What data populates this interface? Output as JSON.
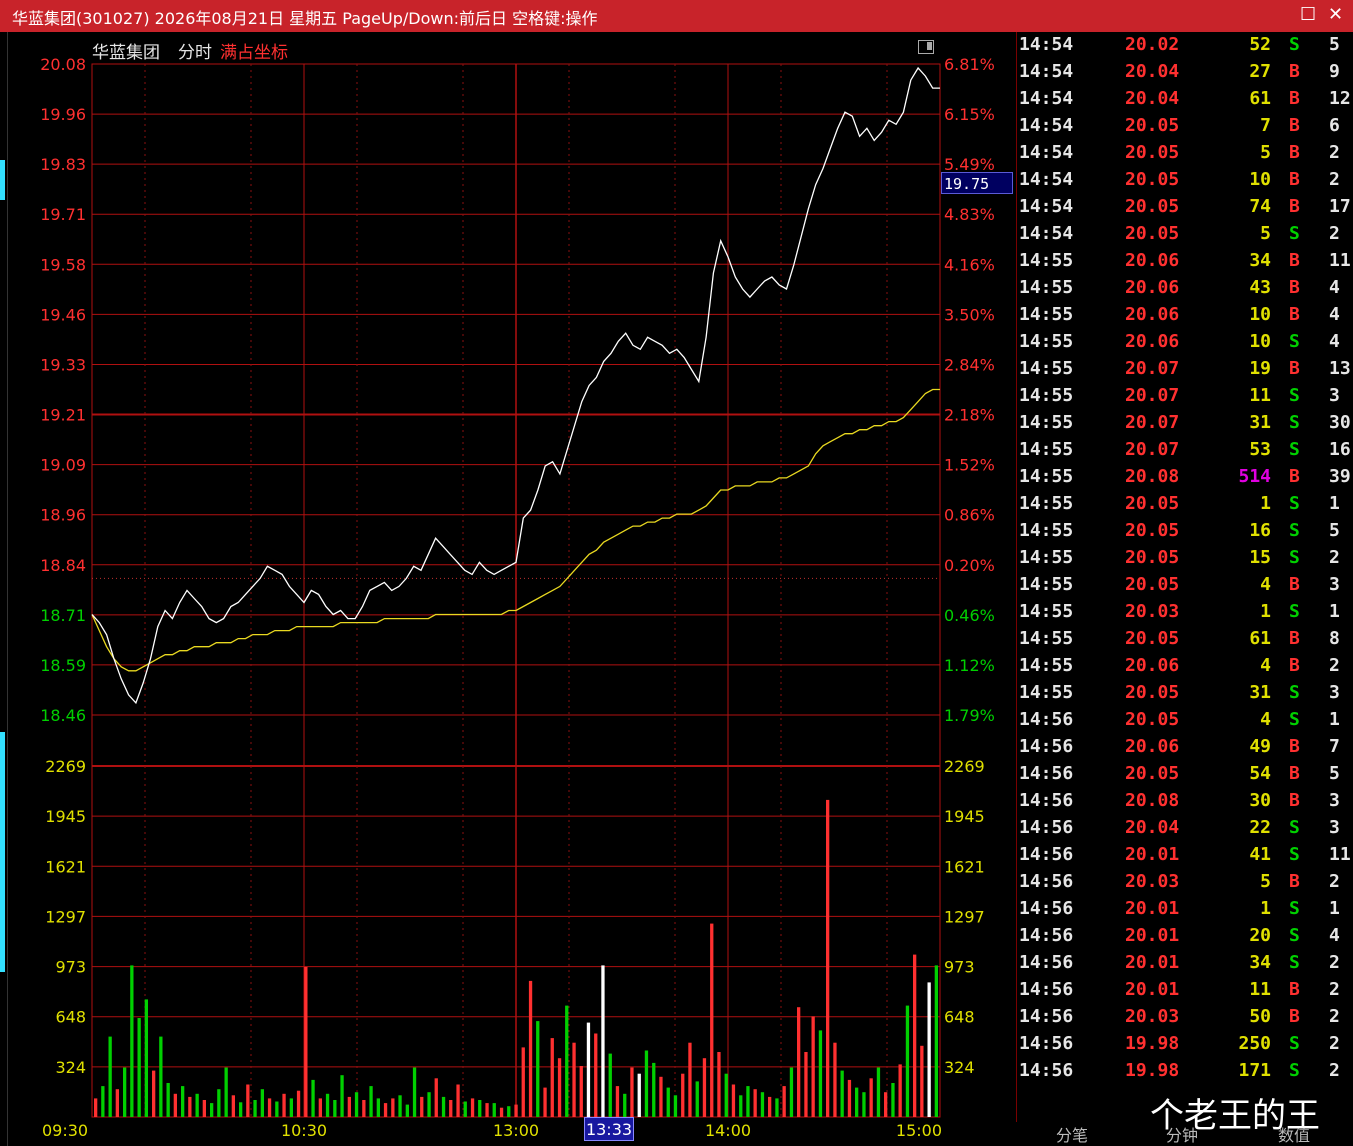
{
  "window": {
    "title": "华蓝集团(301027) 2026年08月21日 星期五 PageUp/Down:前后日 空格键:操作",
    "maximize_icon": "square-icon",
    "close_icon": "close-icon"
  },
  "chart_header": {
    "stock_name": "华蓝集团",
    "mode": "分时",
    "coord_mode": "满占坐标"
  },
  "cursor_price": "19.75",
  "time_cursor": "13:33",
  "colors": {
    "up": "#ff3030",
    "down": "#00d000",
    "price_line": "#ffffff",
    "avg_line": "#e8d820",
    "grid": "#b01010"
  },
  "chart_data": {
    "type": "line",
    "price_axis": {
      "ticks": [
        "20.08",
        "19.96",
        "19.83",
        "19.71",
        "19.58",
        "19.46",
        "19.33",
        "19.21",
        "19.09",
        "18.96",
        "18.84",
        "18.71",
        "18.59",
        "18.46"
      ],
      "tick_colors": [
        "up",
        "up",
        "up",
        "up",
        "up",
        "up",
        "up",
        "up",
        "up",
        "up",
        "up",
        "down",
        "down",
        "down"
      ],
      "ylim": [
        18.46,
        20.08
      ]
    },
    "pct_axis": {
      "ticks": [
        "6.81%",
        "6.15%",
        "5.49%",
        "4.83%",
        "4.16%",
        "3.50%",
        "2.84%",
        "2.18%",
        "1.52%",
        "0.86%",
        "0.20%",
        "0.46%",
        "1.12%",
        "1.79%"
      ],
      "tick_colors": [
        "up",
        "up",
        "up",
        "up",
        "up",
        "up",
        "up",
        "up",
        "up",
        "up",
        "up",
        "down",
        "down",
        "down"
      ]
    },
    "volume_axis": {
      "ticks": [
        "2269",
        "1945",
        "1621",
        "1297",
        "973",
        "648",
        "324"
      ],
      "ylim": [
        0,
        2269
      ]
    },
    "x_ticks": [
      "09:30",
      "10:30",
      "13:00",
      "14:00",
      "15:00"
    ],
    "price_series": {
      "name": "price",
      "values": [
        18.71,
        18.69,
        18.66,
        18.6,
        18.55,
        18.51,
        18.49,
        18.54,
        18.6,
        18.68,
        18.72,
        18.7,
        18.74,
        18.77,
        18.75,
        18.73,
        18.7,
        18.69,
        18.7,
        18.73,
        18.74,
        18.76,
        18.78,
        18.8,
        18.83,
        18.82,
        18.81,
        18.78,
        18.76,
        18.74,
        18.77,
        18.76,
        18.73,
        18.71,
        18.72,
        18.7,
        18.7,
        18.73,
        18.77,
        18.78,
        18.79,
        18.77,
        18.78,
        18.8,
        18.83,
        18.82,
        18.86,
        18.9,
        18.88,
        18.86,
        18.84,
        18.82,
        18.81,
        18.84,
        18.82,
        18.81,
        18.82,
        18.83,
        18.84,
        18.95,
        18.97,
        19.02,
        19.08,
        19.09,
        19.06,
        19.12,
        19.18,
        19.24,
        19.28,
        19.3,
        19.34,
        19.36,
        19.39,
        19.41,
        19.38,
        19.37,
        19.4,
        19.39,
        19.38,
        19.36,
        19.37,
        19.35,
        19.32,
        19.29,
        19.4,
        19.56,
        19.64,
        19.6,
        19.55,
        19.52,
        19.5,
        19.52,
        19.54,
        19.55,
        19.53,
        19.52,
        19.58,
        19.65,
        19.72,
        19.78,
        19.82,
        19.87,
        19.92,
        19.96,
        19.95,
        19.9,
        19.92,
        19.89,
        19.91,
        19.94,
        19.93,
        19.96,
        20.04,
        20.07,
        20.05,
        20.02,
        20.02
      ]
    },
    "avg_series": {
      "name": "avg",
      "values": [
        18.71,
        18.67,
        18.63,
        18.6,
        18.58,
        18.57,
        18.57,
        18.58,
        18.59,
        18.6,
        18.61,
        18.61,
        18.62,
        18.62,
        18.63,
        18.63,
        18.63,
        18.64,
        18.64,
        18.64,
        18.65,
        18.65,
        18.66,
        18.66,
        18.66,
        18.67,
        18.67,
        18.67,
        18.68,
        18.68,
        18.68,
        18.68,
        18.68,
        18.68,
        18.69,
        18.69,
        18.69,
        18.69,
        18.69,
        18.69,
        18.7,
        18.7,
        18.7,
        18.7,
        18.7,
        18.7,
        18.7,
        18.71,
        18.71,
        18.71,
        18.71,
        18.71,
        18.71,
        18.71,
        18.71,
        18.71,
        18.71,
        18.72,
        18.72,
        18.73,
        18.74,
        18.75,
        18.76,
        18.77,
        18.78,
        18.8,
        18.82,
        18.84,
        18.86,
        18.87,
        18.89,
        18.9,
        18.91,
        18.92,
        18.93,
        18.93,
        18.94,
        18.94,
        18.95,
        18.95,
        18.96,
        18.96,
        18.96,
        18.97,
        18.98,
        19.0,
        19.02,
        19.02,
        19.03,
        19.03,
        19.03,
        19.04,
        19.04,
        19.04,
        19.05,
        19.05,
        19.06,
        19.07,
        19.08,
        19.11,
        19.13,
        19.14,
        19.15,
        19.16,
        19.16,
        19.17,
        19.17,
        19.18,
        19.18,
        19.19,
        19.19,
        19.2,
        19.22,
        19.24,
        19.26,
        19.27,
        19.27
      ]
    },
    "volume_series": {
      "name": "volume",
      "values": [
        120,
        200,
        520,
        180,
        320,
        980,
        640,
        760,
        300,
        520,
        220,
        150,
        200,
        130,
        150,
        110,
        90,
        180,
        320,
        140,
        95,
        210,
        110,
        180,
        120,
        100,
        150,
        120,
        170,
        970,
        240,
        120,
        150,
        110,
        270,
        130,
        160,
        110,
        200,
        120,
        90,
        120,
        140,
        80,
        320,
        130,
        160,
        250,
        130,
        110,
        210,
        100,
        120,
        110,
        90,
        90,
        60,
        70,
        80,
        450,
        880,
        620,
        190,
        510,
        380,
        720,
        480,
        330,
        610,
        540,
        980,
        410,
        200,
        150,
        320,
        280,
        430,
        350,
        260,
        190,
        140,
        280,
        480,
        230,
        380,
        1250,
        420,
        280,
        210,
        140,
        200,
        180,
        160,
        130,
        120,
        200,
        320,
        710,
        420,
        650,
        560,
        2050,
        480,
        300,
        240,
        190,
        160,
        250,
        320,
        160,
        220,
        340,
        720,
        1050,
        460,
        870,
        980
      ],
      "colors": [
        "up",
        "down",
        "down",
        "up",
        "down",
        "down",
        "down",
        "down",
        "up",
        "down",
        "down",
        "up",
        "down",
        "up",
        "down",
        "up",
        "down",
        "down",
        "down",
        "up",
        "down",
        "up",
        "down",
        "down",
        "up",
        "down",
        "up",
        "down",
        "up",
        "up",
        "down",
        "up",
        "down",
        "down",
        "down",
        "up",
        "down",
        "up",
        "down",
        "down",
        "up",
        "up",
        "down",
        "down",
        "down",
        "up",
        "down",
        "up",
        "down",
        "up",
        "up",
        "down",
        "up",
        "down",
        "up",
        "down",
        "up",
        "down",
        "up",
        "up",
        "up",
        "down",
        "up",
        "up",
        "up",
        "down",
        "up",
        "up",
        "white",
        "up",
        "white",
        "down",
        "up",
        "down",
        "up",
        "white",
        "down",
        "down",
        "up",
        "down",
        "down",
        "up",
        "up",
        "down",
        "up",
        "up",
        "up",
        "down",
        "up",
        "down",
        "down",
        "up",
        "down",
        "up",
        "down",
        "up",
        "down",
        "up",
        "up",
        "up",
        "down",
        "up",
        "up",
        "down",
        "up",
        "down",
        "down",
        "up",
        "down",
        "up",
        "down",
        "up",
        "down",
        "up",
        "up",
        "white",
        "down"
      ]
    }
  },
  "ticks": [
    {
      "time": "14:54",
      "price": "20.02",
      "vol": "52",
      "side": "S",
      "count": "5"
    },
    {
      "time": "14:54",
      "price": "20.04",
      "vol": "27",
      "side": "B",
      "count": "9"
    },
    {
      "time": "14:54",
      "price": "20.04",
      "vol": "61",
      "side": "B",
      "count": "12"
    },
    {
      "time": "14:54",
      "price": "20.05",
      "vol": "7",
      "side": "B",
      "count": "6"
    },
    {
      "time": "14:54",
      "price": "20.05",
      "vol": "5",
      "side": "B",
      "count": "2"
    },
    {
      "time": "14:54",
      "price": "20.05",
      "vol": "10",
      "side": "B",
      "count": "2"
    },
    {
      "time": "14:54",
      "price": "20.05",
      "vol": "74",
      "side": "B",
      "count": "17"
    },
    {
      "time": "14:54",
      "price": "20.05",
      "vol": "5",
      "side": "S",
      "count": "2"
    },
    {
      "time": "14:55",
      "price": "20.06",
      "vol": "34",
      "side": "B",
      "count": "11"
    },
    {
      "time": "14:55",
      "price": "20.06",
      "vol": "43",
      "side": "B",
      "count": "4"
    },
    {
      "time": "14:55",
      "price": "20.06",
      "vol": "10",
      "side": "B",
      "count": "4"
    },
    {
      "time": "14:55",
      "price": "20.06",
      "vol": "10",
      "side": "S",
      "count": "4"
    },
    {
      "time": "14:55",
      "price": "20.07",
      "vol": "19",
      "side": "B",
      "count": "13"
    },
    {
      "time": "14:55",
      "price": "20.07",
      "vol": "11",
      "side": "S",
      "count": "3"
    },
    {
      "time": "14:55",
      "price": "20.07",
      "vol": "31",
      "side": "S",
      "count": "30"
    },
    {
      "time": "14:55",
      "price": "20.07",
      "vol": "53",
      "side": "S",
      "count": "16"
    },
    {
      "time": "14:55",
      "price": "20.08",
      "vol": "514",
      "side": "B",
      "count": "39"
    },
    {
      "time": "14:55",
      "price": "20.05",
      "vol": "1",
      "side": "S",
      "count": "1"
    },
    {
      "time": "14:55",
      "price": "20.05",
      "vol": "16",
      "side": "S",
      "count": "5"
    },
    {
      "time": "14:55",
      "price": "20.05",
      "vol": "15",
      "side": "S",
      "count": "2"
    },
    {
      "time": "14:55",
      "price": "20.05",
      "vol": "4",
      "side": "B",
      "count": "3"
    },
    {
      "time": "14:55",
      "price": "20.03",
      "vol": "1",
      "side": "S",
      "count": "1"
    },
    {
      "time": "14:55",
      "price": "20.05",
      "vol": "61",
      "side": "B",
      "count": "8"
    },
    {
      "time": "14:55",
      "price": "20.06",
      "vol": "4",
      "side": "B",
      "count": "2"
    },
    {
      "time": "14:55",
      "price": "20.05",
      "vol": "31",
      "side": "S",
      "count": "3"
    },
    {
      "time": "14:56",
      "price": "20.05",
      "vol": "4",
      "side": "S",
      "count": "1"
    },
    {
      "time": "14:56",
      "price": "20.06",
      "vol": "49",
      "side": "B",
      "count": "7"
    },
    {
      "time": "14:56",
      "price": "20.05",
      "vol": "54",
      "side": "B",
      "count": "5"
    },
    {
      "time": "14:56",
      "price": "20.08",
      "vol": "30",
      "side": "B",
      "count": "3"
    },
    {
      "time": "14:56",
      "price": "20.04",
      "vol": "22",
      "side": "S",
      "count": "3"
    },
    {
      "time": "14:56",
      "price": "20.01",
      "vol": "41",
      "side": "S",
      "count": "11"
    },
    {
      "time": "14:56",
      "price": "20.03",
      "vol": "5",
      "side": "B",
      "count": "2"
    },
    {
      "time": "14:56",
      "price": "20.01",
      "vol": "1",
      "side": "S",
      "count": "1"
    },
    {
      "time": "14:56",
      "price": "20.01",
      "vol": "20",
      "side": "S",
      "count": "4"
    },
    {
      "time": "14:56",
      "price": "20.01",
      "vol": "34",
      "side": "S",
      "count": "2"
    },
    {
      "time": "14:56",
      "price": "20.01",
      "vol": "11",
      "side": "B",
      "count": "2"
    },
    {
      "time": "14:56",
      "price": "20.03",
      "vol": "50",
      "side": "B",
      "count": "2"
    },
    {
      "time": "14:56",
      "price": "19.98",
      "vol": "250",
      "side": "S",
      "count": "2"
    },
    {
      "time": "14:56",
      "price": "19.98",
      "vol": "171",
      "side": "S",
      "count": "2"
    }
  ],
  "bottom_tabs": [
    "分笔",
    "分钟",
    "数值"
  ],
  "watermark": "个老王的王"
}
